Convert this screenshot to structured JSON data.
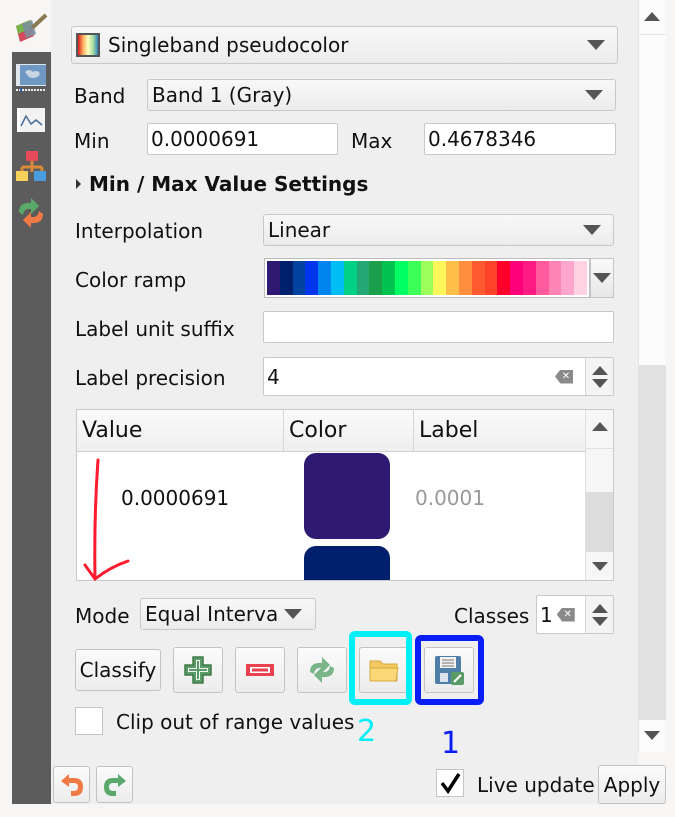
{
  "renderer": {
    "selected": "Singleband pseudocolor",
    "icon": "gradient-swatch-icon"
  },
  "band": {
    "label": "Band",
    "selected": "Band 1 (Gray)"
  },
  "min": {
    "label": "Min",
    "value": "0.0000691"
  },
  "max": {
    "label": "Max",
    "value": "0.4678346"
  },
  "minmax_section": {
    "label": "Min / Max Value Settings",
    "expanded": false
  },
  "interpolation": {
    "label": "Interpolation",
    "selected": "Linear"
  },
  "color_ramp": {
    "label": "Color ramp",
    "colors": [
      "#2f1a73",
      "#00206e",
      "#00429e",
      "#0035ee",
      "#0084f0",
      "#00bdf4",
      "#00d184",
      "#23a773",
      "#1a9f4a",
      "#00c24e",
      "#00ff62",
      "#3cff57",
      "#9dff59",
      "#fff75a",
      "#ffbf49",
      "#ff8f3f",
      "#ff5a2f",
      "#ff432b",
      "#ff002a",
      "#ff0079",
      "#ff1b84",
      "#ff5a9e",
      "#ff85b4",
      "#ffa6cc",
      "#ffd2e2"
    ]
  },
  "label_unit_suffix": {
    "label": "Label unit suffix",
    "value": ""
  },
  "label_precision": {
    "label": "Label precision",
    "value": "4"
  },
  "table": {
    "columns": [
      "Value",
      "Color",
      "Label"
    ],
    "rows": [
      {
        "value": "0.0000691",
        "color": "#2f1a73",
        "label": "0.0001"
      },
      {
        "value": "",
        "color": "#00206e",
        "label": ""
      }
    ]
  },
  "mode": {
    "label": "Mode",
    "selected": "Equal Interva"
  },
  "classes": {
    "label": "Classes",
    "value": "1"
  },
  "buttons": {
    "classify": "Classify",
    "add": "add-class",
    "remove": "remove-class",
    "reverse": "reverse-colors",
    "load": "load-from-file",
    "save": "export-to-file"
  },
  "clip": {
    "label": "Clip out of range values",
    "checked": false
  },
  "annotations": {
    "label_1": "1",
    "color_1": "#0a1df5",
    "label_2": "2",
    "color_2": "#00f0f8",
    "arrow_color": "#ff1a2e"
  },
  "footer": {
    "live_update_label": "Live update",
    "live_update_checked": true,
    "apply": "Apply"
  }
}
